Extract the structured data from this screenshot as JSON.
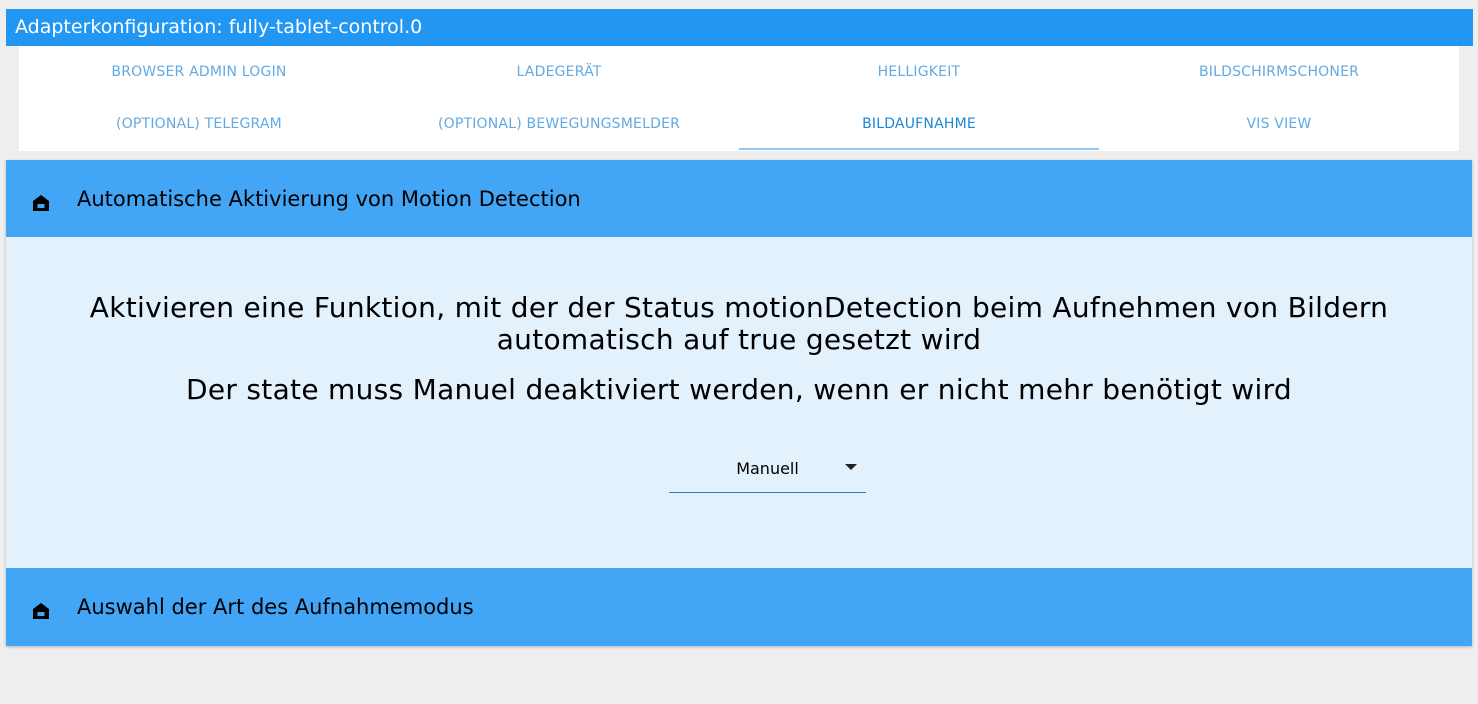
{
  "window": {
    "title": "Adapterkonfiguration: fully-tablet-control.0"
  },
  "tabs": {
    "row1": [
      {
        "label": "BROWSER ADMIN LOGIN"
      },
      {
        "label": "LADEGERÄT"
      },
      {
        "label": "HELLIGKEIT"
      },
      {
        "label": "BILDSCHIRMSCHONER"
      }
    ],
    "row2": [
      {
        "label": "(OPTIONAL) TELEGRAM"
      },
      {
        "label": "(OPTIONAL) BEWEGUNGSMELDER"
      },
      {
        "label": "BILDAUFNAHME"
      },
      {
        "label": "VIS VIEW"
      }
    ],
    "active": "BILDAUFNAHME"
  },
  "sections": [
    {
      "title": "Automatische Aktivierung von Motion Detection",
      "icon": "home-icon",
      "description_line1": "Aktivieren eine Funktion, mit der der Status motionDetection beim Aufnehmen von Bildern automatisch auf true gesetzt wird",
      "description_line2": "Der state muss Manuel deaktiviert werden, wenn er nicht mehr benötigt wird",
      "select": {
        "value": "Manuell"
      }
    },
    {
      "title": "Auswahl der Art des Aufnahmemodus",
      "icon": "home-icon"
    }
  ],
  "colors": {
    "titlebar": "#2196f3",
    "section_header": "#42a5f5",
    "section_body": "#e3f1fc",
    "tab_text": "#64a9e0",
    "tab_active_indicator": "#90caf9",
    "background": "#eeeeee"
  }
}
